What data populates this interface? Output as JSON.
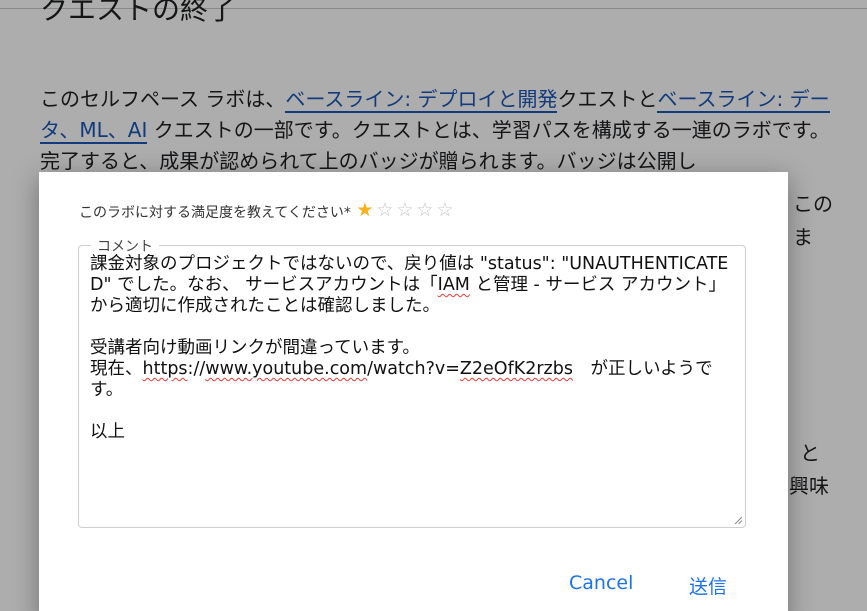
{
  "background": {
    "heading": "クエストの終了",
    "para_before": "このセルフペース ラボは、",
    "link1": "ベースライン: デプロイと開発",
    "para_mid": "クエストと",
    "link2": "ベースライン: データ、ML、AI",
    "para_after": " クエストの一部です。クエストとは、学習パスを構成する一連のラボです。完了すると、成果が認められて上のバッジが贈られます。バッジは公開し",
    "frag_kono": "この",
    "frag_ma": "ま",
    "frag_to": "と",
    "frag_kyomi": "興味"
  },
  "dialog": {
    "rating_label": "このラボに対する満足度を教えてください*",
    "rating": {
      "value": 1,
      "max": 5,
      "filled_color": "#f6b11d",
      "empty_color": "#c4c4c4"
    },
    "comment": {
      "legend": "コメント",
      "line1": "課金対象のプロジェクトではないので、戻り値は \"status\": \"UNAUTHENTICATED\" でした。なお、 サービスアカウントは「",
      "iam": "IAM",
      "line1b": " と管理 - サービス アカウント」から適切に作成されたことは確認しました。",
      "line2": "受講者向け動画リンクが間違っています。",
      "line3_prefix": "現在、",
      "url_a": "https",
      "url_b": "://",
      "url_c": "www.youtube.com",
      "url_d": "/watch?v=",
      "url_e": "Z2eOfK2rzbs",
      "line3_suffix": "　が正しいようです。",
      "line4": "以上"
    },
    "buttons": {
      "cancel": "Cancel",
      "submit": "送信"
    }
  }
}
